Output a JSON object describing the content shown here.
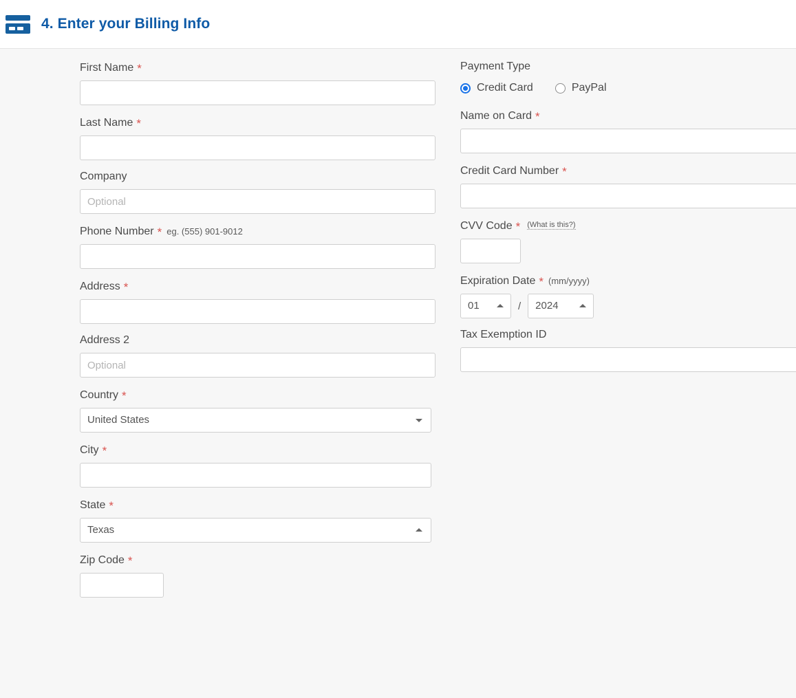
{
  "header": {
    "icon": "credit-card-icon",
    "title": "4. Enter your Billing Info"
  },
  "colors": {
    "title_blue": "#0f5ba7",
    "required_red": "#d9534f",
    "radio_accent": "#1a73e8",
    "page_background": "#f7f7f7",
    "header_background": "#ffffff",
    "input_border": "#cfcfcf"
  },
  "left_column": {
    "first_name": {
      "label": "First Name",
      "required_marker": "*",
      "value": "",
      "placeholder": ""
    },
    "last_name": {
      "label": "Last Name",
      "required_marker": "*",
      "value": "",
      "placeholder": ""
    },
    "company": {
      "label": "Company",
      "value": "",
      "placeholder": "Optional"
    },
    "phone_number": {
      "label": "Phone Number",
      "required_marker": "*",
      "hint": "eg. (555) 901-9012",
      "value": "",
      "placeholder": ""
    },
    "address": {
      "label": "Address",
      "required_marker": "*",
      "value": "",
      "placeholder": ""
    },
    "address2": {
      "label": "Address 2",
      "value": "",
      "placeholder": "Optional"
    },
    "country": {
      "label": "Country",
      "required_marker": "*",
      "value": "United States",
      "caret": "chevron-down-icon"
    },
    "city": {
      "label": "City",
      "required_marker": "*",
      "value": "",
      "placeholder": ""
    },
    "state": {
      "label": "State",
      "required_marker": "*",
      "value": "Texas",
      "caret": "chevron-up-icon"
    },
    "zip_code": {
      "label": "Zip Code",
      "required_marker": "*",
      "value": "",
      "placeholder": ""
    }
  },
  "right_column": {
    "payment_type": {
      "label": "Payment Type",
      "options": [
        {
          "label": "Credit Card",
          "checked": true
        },
        {
          "label": "PayPal",
          "checked": false
        }
      ]
    },
    "name_on_card": {
      "label": "Name on Card",
      "required_marker": "*",
      "value": "",
      "placeholder": ""
    },
    "credit_card_number": {
      "label": "Credit Card Number",
      "required_marker": "*",
      "value": "",
      "placeholder": ""
    },
    "cvv_code": {
      "label": "CVV Code",
      "required_marker": "*",
      "help_link": "(What is this?)",
      "value": "",
      "placeholder": ""
    },
    "expiration_date": {
      "label": "Expiration Date",
      "required_marker": "*",
      "format_hint": "(mm/yyyy)",
      "separator": "/",
      "month_value": "01",
      "year_value": "2024",
      "month_caret": "chevron-up-icon",
      "year_caret": "chevron-up-icon"
    },
    "tax_exemption_id": {
      "label": "Tax Exemption ID",
      "value": "",
      "placeholder": ""
    }
  }
}
